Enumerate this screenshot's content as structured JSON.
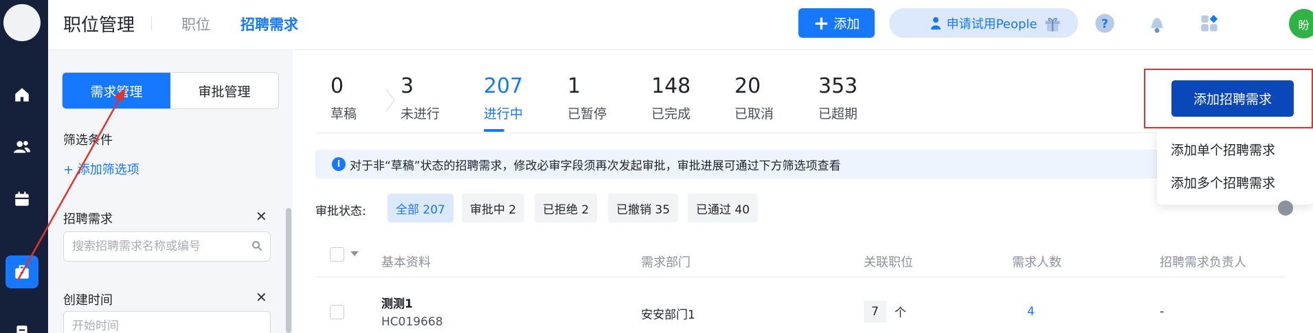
{
  "header": {
    "title": "职位管理",
    "tabs": [
      {
        "label": "职位",
        "active": false
      },
      {
        "label": "招聘需求",
        "active": true
      }
    ],
    "add_button": "添加",
    "trial_button": "申请试用People",
    "avatar_initial": "盼"
  },
  "nav": {
    "icons": [
      "home-icon",
      "people-icon",
      "calendar-icon",
      "briefcase-icon",
      "document-icon"
    ],
    "active_icon": "briefcase-icon"
  },
  "panel": {
    "segments": [
      {
        "label": "需求管理",
        "active": true
      },
      {
        "label": "审批管理",
        "active": false
      }
    ],
    "filter_title": "筛选条件",
    "add_filter": "添加筛选项",
    "demand_label": "招聘需求",
    "demand_placeholder": "搜索招聘需求名称或编号",
    "created_label": "创建时间",
    "created_placeholder": "开始时间"
  },
  "stats": [
    {
      "value": "0",
      "label": "草稿"
    },
    {
      "value": "3",
      "label": "未进行"
    },
    {
      "value": "207",
      "label": "进行中",
      "active": true
    },
    {
      "value": "1",
      "label": "已暂停"
    },
    {
      "value": "148",
      "label": "已完成"
    },
    {
      "value": "20",
      "label": "已取消"
    },
    {
      "value": "353",
      "label": "已超期"
    }
  ],
  "info_text": "对于非“草稿”状态的招聘需求，修改必审字段须再次发起审批，审批进展可通过下方筛选项查看",
  "approval": {
    "label": "审批状态:",
    "chips": [
      {
        "label": "全部 207",
        "active": true
      },
      {
        "label": "审批中 2"
      },
      {
        "label": "已拒绝 2"
      },
      {
        "label": "已撤销 35"
      },
      {
        "label": "已通过 40"
      }
    ]
  },
  "table": {
    "columns": [
      "基本资料",
      "需求部门",
      "关联职位",
      "需求人数",
      "招聘需求负责人"
    ],
    "rows": [
      {
        "name": "测测1",
        "code": "HC019668",
        "dept": "安安部门1",
        "positions": "7",
        "positions_unit": "个",
        "headcount": "4",
        "owner": "-"
      }
    ]
  },
  "actions": {
    "primary": "添加招聘需求",
    "menu": [
      "添加单个招聘需求",
      "添加多个招聘需求"
    ]
  },
  "colors": {
    "accent": "#1677ff",
    "nav_bg": "#15213a",
    "primary_dark": "#0a47b8",
    "annotation": "#e5312c"
  }
}
